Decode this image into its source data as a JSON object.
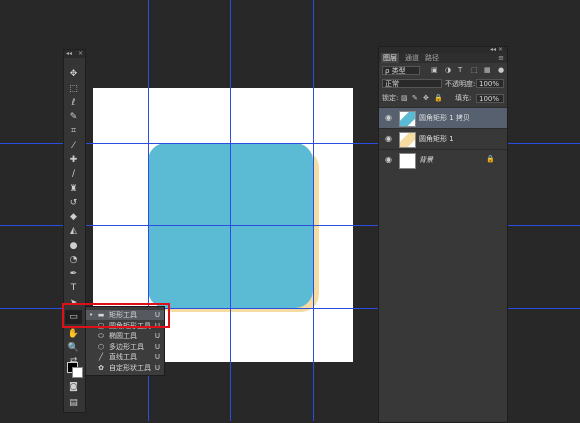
{
  "toolbar": {
    "grip_left": "◂◂",
    "grip_right": "×",
    "tools": [
      {
        "name": "move-tool",
        "icon": "✥"
      },
      {
        "name": "marquee-tool",
        "icon": "⬚"
      },
      {
        "name": "lasso-tool",
        "icon": "ℓ"
      },
      {
        "name": "quick-select-tool",
        "icon": "✎"
      },
      {
        "name": "crop-tool",
        "icon": "⌗"
      },
      {
        "name": "eyedropper-tool",
        "icon": "⁄"
      },
      {
        "name": "healing-tool",
        "icon": "✚"
      },
      {
        "name": "brush-tool",
        "icon": "∕"
      },
      {
        "name": "stamp-tool",
        "icon": "♜"
      },
      {
        "name": "history-brush-tool",
        "icon": "↺"
      },
      {
        "name": "eraser-tool",
        "icon": "◆"
      },
      {
        "name": "bucket-tool",
        "icon": "◭"
      },
      {
        "name": "blur-tool",
        "icon": "●"
      },
      {
        "name": "dodge-tool",
        "icon": "◔"
      },
      {
        "name": "pen-tool",
        "icon": "✒"
      },
      {
        "name": "type-tool",
        "icon": "T"
      },
      {
        "name": "path-select-tool",
        "icon": "➤"
      },
      {
        "name": "rectangle-tool",
        "icon": "▭"
      },
      {
        "name": "hand-tool",
        "icon": "✋"
      },
      {
        "name": "zoom-tool",
        "icon": "🔍"
      },
      {
        "name": "swap-colors-icon",
        "icon": "⇄"
      },
      {
        "name": "quick-mask-icon",
        "icon": "◙"
      },
      {
        "name": "screen-mode-icon",
        "icon": "▤"
      }
    ]
  },
  "flyout": {
    "items": [
      {
        "label": "矩形工具",
        "key": "U",
        "icon": "▬",
        "bullet": "•"
      },
      {
        "label": "圆角矩形工具",
        "key": "U",
        "icon": "▢",
        "bullet": ""
      },
      {
        "label": "椭圆工具",
        "key": "U",
        "icon": "⬭",
        "bullet": ""
      },
      {
        "label": "多边形工具",
        "key": "U",
        "icon": "⬡",
        "bullet": ""
      },
      {
        "label": "直线工具",
        "key": "U",
        "icon": "╱",
        "bullet": ""
      },
      {
        "label": "自定形状工具",
        "key": "U",
        "icon": "✿",
        "bullet": ""
      }
    ]
  },
  "layers_panel": {
    "top_icons": "◂◂ ×",
    "tabs": [
      "图层",
      "通道",
      "路径"
    ],
    "menu_icon": "≡",
    "filter": {
      "search_icon": "ρ",
      "kind": "类型",
      "icons": [
        "▣",
        "◑",
        "T",
        "⬚",
        "▦"
      ],
      "toggle": "●"
    },
    "blend_mode": "正常",
    "opacity_label": "不透明度:",
    "opacity_value": "100%",
    "lock_label": "锁定:",
    "lock_icons": [
      "▨",
      "✎",
      "✥",
      "🔒"
    ],
    "fill_label": "填充:",
    "fill_value": "100%",
    "layers": [
      {
        "name": "圆角矩形 1 拷贝",
        "selected": true,
        "locked": false,
        "italic": false
      },
      {
        "name": "圆角矩形 1",
        "selected": false,
        "locked": false,
        "italic": false
      },
      {
        "name": "背景",
        "selected": false,
        "locked": true,
        "italic": true
      }
    ],
    "eye_icon": "◉",
    "lock_icon": "🔒"
  },
  "colors": {
    "shape_fill": "#5bbbd4",
    "shape_shadow": "#f6dca0",
    "guide": "#2a4fe0",
    "highlight_box": "#e0101a"
  }
}
